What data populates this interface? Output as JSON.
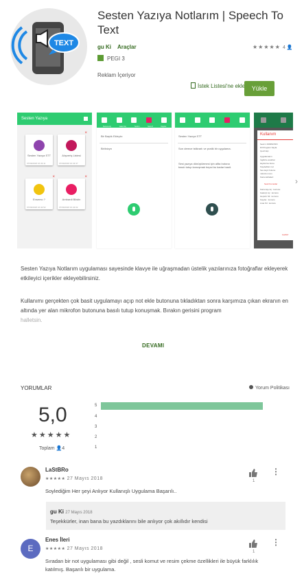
{
  "app": {
    "title": "Sesten Yazıya Notlarım | Speech To Text",
    "developer": "gu Ki",
    "category": "Araçlar",
    "rating_count_top": "4",
    "pegi": "PEGI 3",
    "ads": "Reklam İçeriyor",
    "wishlist": "İstek Listesi'ne ekle",
    "install": "Yükle",
    "icon_text": "TEXT"
  },
  "screenshots": {
    "s1": {
      "header": "Sesten Yazıya",
      "cards": [
        {
          "label": "Sesten Yazıya STT",
          "date": "07/09/2018 16:43:11",
          "color": "#8e44ad"
        },
        {
          "label": "Alışveriş Listesi",
          "date": "07/09/2018 16:43:37",
          "color": "#c2185b"
        },
        {
          "label": "Ensemo ?",
          "date": "07/09/2018 16:42:52",
          "color": "#f1c40f"
        },
        {
          "label": "Ambardi Bilstin",
          "date": "07/09/2018 16:43:02",
          "color": "#e91e63"
        }
      ]
    },
    "s2": {
      "toolbar": [
        "Kamera Aç",
        "Galeri Aç",
        "Yardım",
        "Sesi Al",
        "Kaydet"
      ],
      "title_ph": "Bir Başlık Ekleyin:",
      "body_ph": "Birilnizyn"
    },
    "s3": {
      "title": "Sesten Yazıya STT",
      "p1": "Son derece istikrarlı ve pratik bir uygulama.",
      "p2": "Sesi yazıya dönüştürmesi için altta butona basılı tutup konuşmak hepsi bu kadar basit."
    },
    "s4": {
      "dialog_title": "Kullanım",
      "lines": [
        "Sesli 1 FRMSO'RO",
        "Dil Program Sayfa",
        "Çevrimiçi.",
        "Uygulamanın",
        "İngilizce anahtar",
        "kaydetme ikonu",
        "Kaydedilen not",
        "Ses kayıt butonu",
        "mikrofon icon",
        "Kamera/Galeri"
      ],
      "link": "Sesli Komutlar",
      "more_lines": [
        "Kamerayı Aç : komutu",
        "Galeriyi Aç : komutu",
        "Hepsini Sil : komutu",
        "Kaydet : komutu",
        "Liste Sil : komutu"
      ],
      "ok": "KAPAT"
    }
  },
  "description": {
    "p1": "Sesten Yazıya Notlarım uygulaması sayesinde klavye ile uğraşmadan üstelik yazılarınıza fotoğraflar ekleyerek etkileyici içerikler ekleyebilirsiniz.",
    "p2": "Kullanımı gerçekten çok basit uygulamayı açıp not ekle butonuna tıkladıktan sonra karşımıza çıkan ekranın en altında yer alan mikrofon butonuna basılı tutup konuşmak. Bırakın gerisini program",
    "p3": "halletsin.",
    "more": "DEVAMI"
  },
  "reviews": {
    "heading": "YORUMLAR",
    "policy": "Yorum Politikası",
    "score": "5,0",
    "total_label": "Toplam",
    "total_count": "4",
    "bars": [
      "5",
      "4",
      "3",
      "2",
      "1"
    ],
    "items": [
      {
        "name": "LaStBRo",
        "date": "27 Mayıs 2018",
        "text": "Soylediğim Her şeyi Anlıyor Kullanışlı Uygulama Başarılı..",
        "likes": "1"
      },
      {
        "name": "Enes İleri",
        "date": "27 Mayıs 2018",
        "text": "Sıradan bir not uygulaması gibi değil , sesli komut ve resim çekme özellikleri ile büyük farklılık katılmış. Başarılı bir uygulama.",
        "likes": "1",
        "initial": "E"
      }
    ],
    "reply": {
      "name": "gu Ki",
      "date": "27 Mayıs 2018",
      "text": "Teşekkürler, inan bana bu yazdıklarını bile anlıyor çok akıllıdır kendisi"
    }
  },
  "colors": {
    "accent": "#689f38",
    "app_green": "#2ecc71",
    "bar": "#7ec69a"
  }
}
